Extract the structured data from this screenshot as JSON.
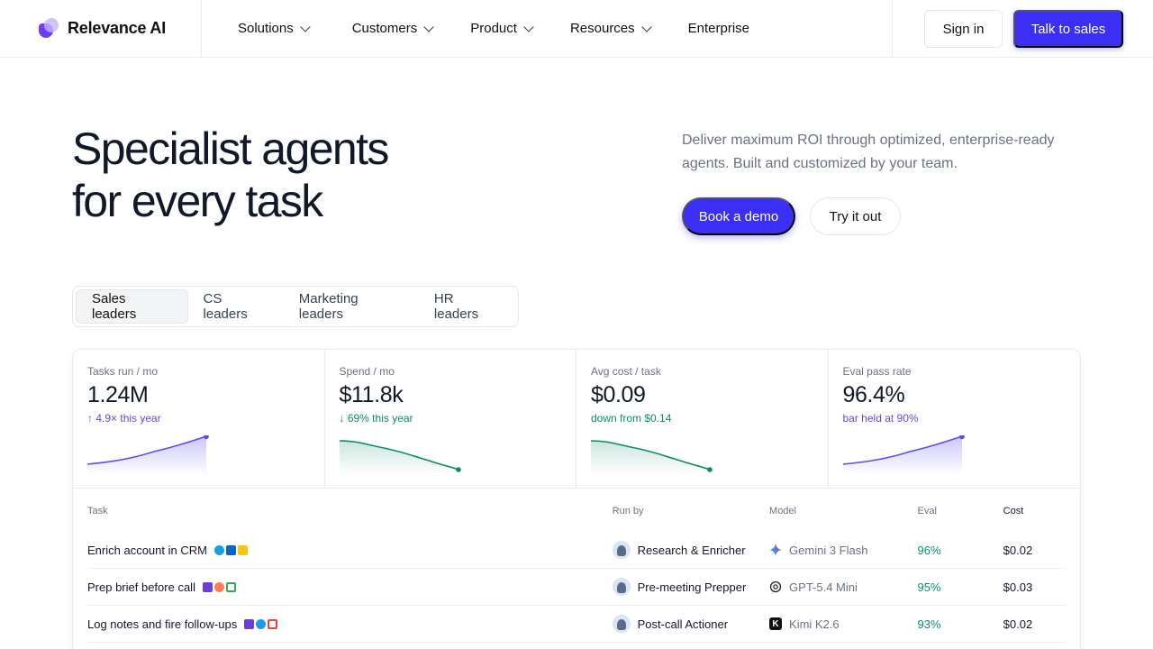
{
  "nav": {
    "brand": "Relevance AI",
    "menu": [
      {
        "label": "Solutions",
        "dropdown": true
      },
      {
        "label": "Customers",
        "dropdown": true
      },
      {
        "label": "Product",
        "dropdown": true
      },
      {
        "label": "Resources",
        "dropdown": true
      },
      {
        "label": "Enterprise",
        "dropdown": false
      }
    ],
    "sign_in": "Sign in",
    "talk_to_sales": "Talk to sales"
  },
  "hero": {
    "title_line1": "Specialist agents",
    "title_line2": "for every task",
    "subtitle": "Deliver maximum ROI through optimized, enterprise-ready agents. Built and customized by your team.",
    "primary_cta": "Book a demo",
    "secondary_cta": "Try it out"
  },
  "tabs": [
    {
      "label": "Sales leaders",
      "active": true
    },
    {
      "label": "CS leaders",
      "active": false
    },
    {
      "label": "Marketing leaders",
      "active": false
    },
    {
      "label": "HR leaders",
      "active": false
    }
  ],
  "kpis": [
    {
      "label": "Tasks run / mo",
      "value": "1.24M",
      "delta": "↑ 4.9× this year",
      "trend": "up"
    },
    {
      "label": "Spend / mo",
      "value": "$11.8k",
      "delta": "↓ 69% this year",
      "trend": "down"
    },
    {
      "label": "Avg cost / task",
      "value": "$0.09",
      "delta": "down from $0.14",
      "trend": "down"
    },
    {
      "label": "Eval pass rate",
      "value": "96.4%",
      "delta": "bar held at 90%",
      "trend": "up"
    }
  ],
  "table": {
    "headers": {
      "task": "Task",
      "run_by": "Run by",
      "model": "Model",
      "eval": "Eval",
      "cost": "Cost"
    },
    "rows": [
      {
        "task": "Enrich account in CRM",
        "tools": [
          "salesforce",
          "linkedin",
          "apollo"
        ],
        "run_by": "Research & Enricher",
        "model": "Gemini 3 Flash",
        "model_icon": "gemini-icon",
        "eval": "96%",
        "cost": "$0.02"
      },
      {
        "task": "Prep brief before call",
        "tools": [
          "gong",
          "hubspot",
          "google-calendar"
        ],
        "run_by": "Pre-meeting Prepper",
        "model": "GPT-5.4 Mini",
        "model_icon": "openai-icon",
        "eval": "95%",
        "cost": "$0.03"
      },
      {
        "task": "Log notes and fire follow-ups",
        "tools": [
          "gong",
          "salesforce",
          "gmail"
        ],
        "run_by": "Post-call Actioner",
        "model": "Kimi K2.6",
        "model_icon": "kimi-icon",
        "eval": "93%",
        "cost": "$0.02"
      }
    ]
  },
  "colors": {
    "accent": "#3b2ff5",
    "trend_up": "#5b4fe0",
    "trend_down": "#0f8a6b"
  }
}
